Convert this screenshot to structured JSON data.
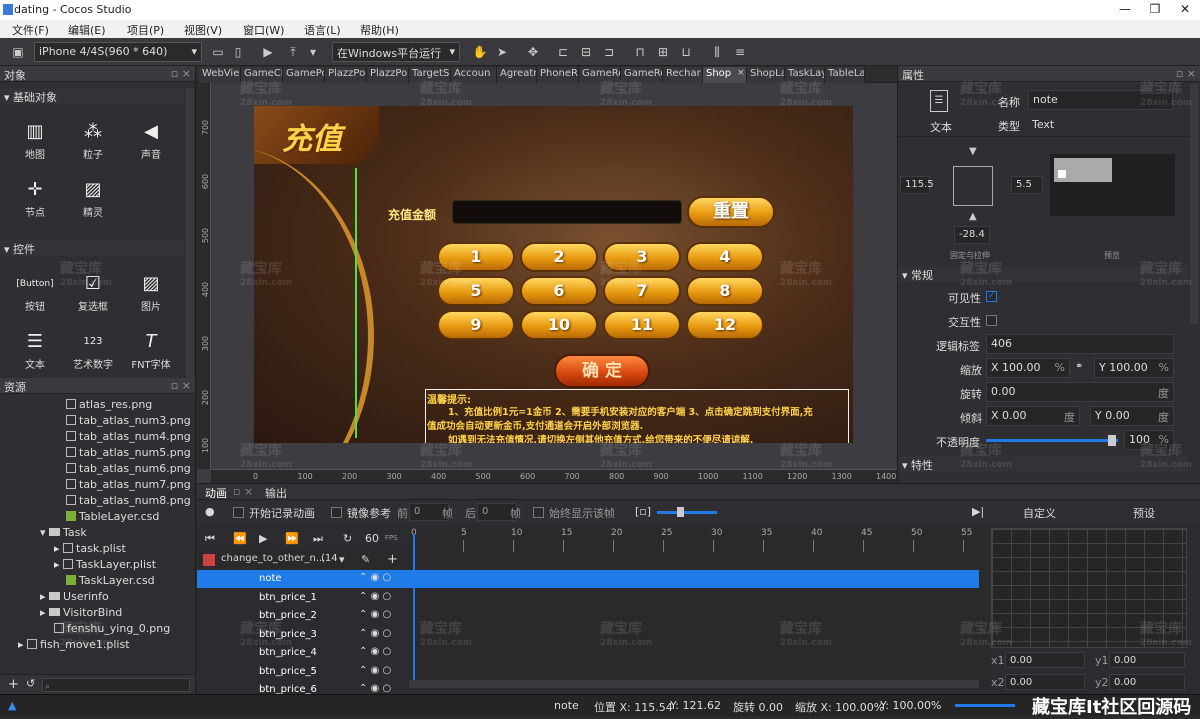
{
  "window": {
    "title": "dating - Cocos Studio",
    "min": "—",
    "max": "❐",
    "close": "✕"
  },
  "menu": [
    "文件(F)",
    "编辑(E)",
    "项目(P)",
    "视图(V)",
    "窗口(W)",
    "语言(L)",
    "帮助(H)"
  ],
  "toolbar": {
    "device": "iPhone 4/4S(960 * 640)",
    "run_target": "在Windows平台运行"
  },
  "objects_panel": {
    "title": "对象",
    "basic_section": "基础对象",
    "basic_items": [
      {
        "label": "地图",
        "icon": "map-icon"
      },
      {
        "label": "粒子",
        "icon": "particle-icon"
      },
      {
        "label": "声音",
        "icon": "sound-icon"
      },
      {
        "label": "节点",
        "icon": "node-icon"
      },
      {
        "label": "精灵",
        "icon": "sprite-icon"
      }
    ],
    "controls_section": "控件",
    "control_items": [
      {
        "label": "按钮",
        "icon": "button-icon"
      },
      {
        "label": "复选框",
        "icon": "checkbox-icon"
      },
      {
        "label": "图片",
        "icon": "image-icon"
      },
      {
        "label": "文本",
        "icon": "text-icon"
      },
      {
        "label": "艺术数字",
        "icon": "art-number-icon"
      },
      {
        "label": "FNT字体",
        "icon": "fnt-font-icon"
      }
    ]
  },
  "resources_panel": {
    "title": "资源",
    "tree": [
      {
        "label": "atlas_res.png",
        "type": "file",
        "indent": 2
      },
      {
        "label": "tab_atlas_num3.png",
        "type": "file",
        "indent": 2
      },
      {
        "label": "tab_atlas_num4.png",
        "type": "file",
        "indent": 2
      },
      {
        "label": "tab_atlas_num5.png",
        "type": "file",
        "indent": 2
      },
      {
        "label": "tab_atlas_num6.png",
        "type": "file",
        "indent": 2
      },
      {
        "label": "tab_atlas_num7.png",
        "type": "file",
        "indent": 2
      },
      {
        "label": "tab_atlas_num8.png",
        "type": "file",
        "indent": 2
      },
      {
        "label": "TableLayer.csd",
        "type": "csd",
        "indent": 2
      },
      {
        "label": "Task",
        "type": "folder",
        "indent": 1
      },
      {
        "label": "task.plist",
        "type": "file",
        "indent": 2
      },
      {
        "label": "TaskLayer.plist",
        "type": "file",
        "indent": 2
      },
      {
        "label": "TaskLayer.csd",
        "type": "csd",
        "indent": 2
      },
      {
        "label": "Userinfo",
        "type": "folder",
        "indent": 1
      },
      {
        "label": "VisitorBind",
        "type": "folder",
        "indent": 1
      },
      {
        "label": "fenshu_ying_0.png",
        "type": "file",
        "indent": 1
      },
      {
        "label": "fish_move1.plist",
        "type": "file",
        "indent": 0
      }
    ]
  },
  "doc_tabs": [
    "WebVie",
    "GameCl",
    "GamePo",
    "PlazzPo",
    "PlazzPo",
    "TargetS",
    "Accoun",
    "Agreatn",
    "PhoneR",
    "GameRo",
    "GameRo",
    "Rechar",
    "Shop",
    "ShopLa",
    "TaskLay",
    "TableLa"
  ],
  "active_tab_index": 12,
  "ruler": {
    "v": [
      "700",
      "600",
      "500",
      "400",
      "300",
      "200",
      "100"
    ],
    "h": [
      "0",
      "100",
      "200",
      "300",
      "400",
      "500",
      "600",
      "700",
      "800",
      "900",
      "1000",
      "1100",
      "1200",
      "1300",
      "1400"
    ]
  },
  "game": {
    "title": "充值",
    "amount_label": "充值金额",
    "reset_button": "重置",
    "numbers": [
      "1",
      "2",
      "3",
      "4",
      "5",
      "6",
      "7",
      "8",
      "9",
      "10",
      "11",
      "12"
    ],
    "confirm_button": "确 定",
    "tip_title": "温馨提示:",
    "tip_line1": "1、充值比例1元=1金币 2、需要手机安装对应的客户端 3、点击确定跳到支付界面,充",
    "tip_line2": "值成功会自动更新金币,支付通道会开启外部浏览器.",
    "tip_line3": "如遇到无法充值情况,请切换左侧其他充值方式,给您带来的不便尽请谅解."
  },
  "properties": {
    "title": "属性",
    "type_label_icon": "文本",
    "name_label": "名称",
    "name_value": "note",
    "kind_label": "类型",
    "kind_value": "Text",
    "anchor_left": "115.5",
    "anchor_right": "5.5",
    "anchor_bottom": "-28.4",
    "anchor_caption": "固定与拉伸",
    "preview_caption": "预览",
    "general_section": "常规",
    "visible_label": "可见性",
    "interactive_label": "交互性",
    "tag_label": "逻辑标签",
    "tag_value": "406",
    "scale_label": "缩放",
    "scale_x": "100.00",
    "scale_y": "100.00",
    "rotate_label": "旋转",
    "rotate_value": "0.00",
    "skew_label": "倾斜",
    "skew_x": "0.00",
    "skew_y": "0.00",
    "opacity_label": "不透明度",
    "opacity_value": "100",
    "feature_section": "特性",
    "unit_pct": "%",
    "unit_deg": "度",
    "x": "X",
    "y": "Y"
  },
  "animation": {
    "tab_anim": "动画",
    "tab_output": "输出",
    "record_label": "开始记录动画",
    "mirror_label": "镜像参考",
    "prev_label": "前",
    "prev_val": "0",
    "frame_unit": "帧",
    "next_label": "后",
    "next_val": "0",
    "always_show": "始终显示该帧",
    "fps": "60",
    "fps_unit": "FPS",
    "anim_name": "change_to_other_n...",
    "anim_count": "(14",
    "custom_label": "自定义",
    "preset_label": "预设",
    "ticks": [
      "0",
      "5",
      "10",
      "15",
      "20",
      "25",
      "30",
      "35",
      "40",
      "45",
      "50",
      "55"
    ],
    "tracks": [
      "note",
      "btn_price_1",
      "btn_price_2",
      "btn_price_3",
      "btn_price_4",
      "btn_price_5",
      "btn_price_6"
    ],
    "curve_x1": "x1",
    "curve_x1_val": "0.00",
    "curve_y1": "y1",
    "curve_y1_val": "0.00",
    "curve_x2": "x2",
    "curve_x2_val": "0.00",
    "curve_y2": "y2",
    "curve_y2_val": "0.00"
  },
  "status": {
    "node": "note",
    "pos_label": "位置 X: 115.54",
    "pos_y": "Y: 121.62",
    "rotate": "旋转 0.00",
    "scale_x": "缩放 X: 100.00%",
    "scale_y": "Y: 100.00%"
  },
  "watermark_text": "藏宝库It社区回源码",
  "watermark_small": "藏宝库",
  "watermark_url": "28xin.com",
  "colors": {
    "accent": "#1f7be8",
    "gold": "#f0b030"
  }
}
